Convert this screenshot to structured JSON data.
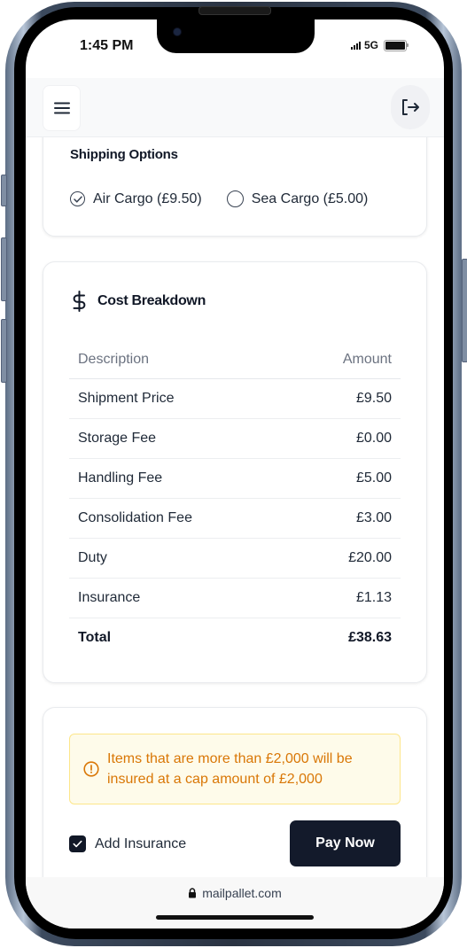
{
  "status_bar": {
    "time": "1:45 PM",
    "network": "5G"
  },
  "header": {
    "menu_icon": "hamburger-menu-icon",
    "logout_icon": "logout-icon"
  },
  "shipping": {
    "title": "Shipping Options",
    "options": [
      {
        "label": "Air Cargo (£9.50)",
        "selected": true
      },
      {
        "label": "Sea Cargo (£5.00)",
        "selected": false
      }
    ]
  },
  "cost_breakdown": {
    "icon": "dollar-icon",
    "title": "Cost Breakdown",
    "columns": [
      "Description",
      "Amount"
    ],
    "rows": [
      {
        "description": "Shipment Price",
        "amount": "£9.50"
      },
      {
        "description": "Storage Fee",
        "amount": "£0.00"
      },
      {
        "description": "Handling Fee",
        "amount": "£5.00"
      },
      {
        "description": "Consolidation Fee",
        "amount": "£3.00"
      },
      {
        "description": "Duty",
        "amount": "£20.00"
      },
      {
        "description": "Insurance",
        "amount": "£1.13"
      }
    ],
    "total": {
      "label": "Total",
      "amount": "£38.63"
    }
  },
  "payment": {
    "alert_text": "Items that are more than £2,000 will be insured at a cap amount of £2,000",
    "insurance_label": "Add Insurance",
    "insurance_checked": true,
    "pay_button": "Pay Now"
  },
  "browser": {
    "url": "mailpallet.com"
  },
  "colors": {
    "primary": "#131a2b",
    "warning_text": "#d97706",
    "warning_bg": "#fefbea",
    "warning_border": "#fde68a"
  }
}
